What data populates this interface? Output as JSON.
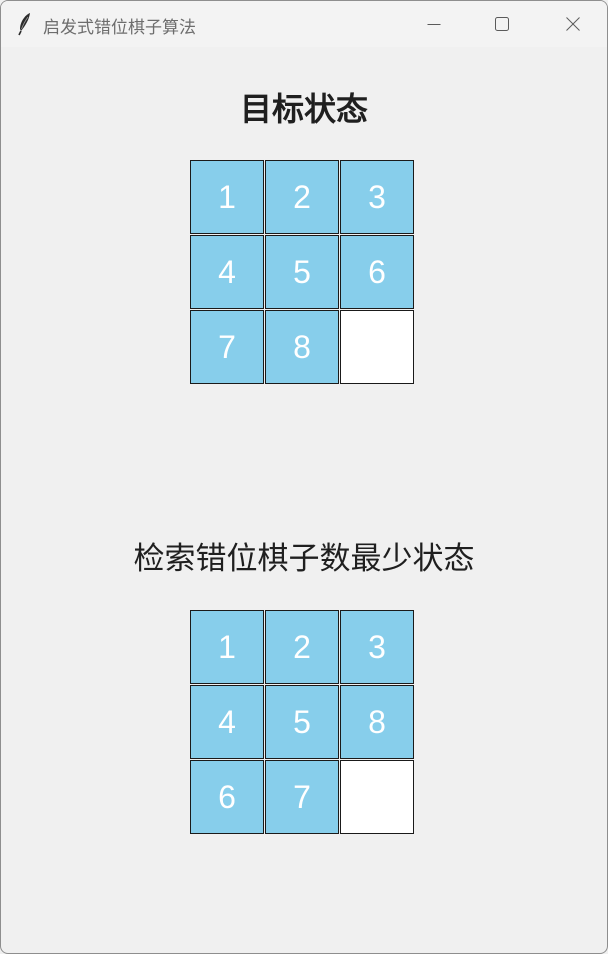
{
  "window": {
    "title": "启发式错位棋子算法",
    "icon": "feather-icon"
  },
  "controls": {
    "minimize_icon": "minimize-icon",
    "maximize_icon": "maximize-icon",
    "close_icon": "close-icon"
  },
  "goal": {
    "heading": "目标状态",
    "tiles": [
      "1",
      "2",
      "3",
      "4",
      "5",
      "6",
      "7",
      "8",
      ""
    ]
  },
  "result": {
    "heading": "检索错位棋子数最少状态",
    "tiles": [
      "1",
      "2",
      "3",
      "4",
      "5",
      "8",
      "6",
      "7",
      ""
    ]
  },
  "colors": {
    "tile_fill": "#87ceeb",
    "empty_fill": "#ffffff",
    "tile_text": "#ffffff",
    "background": "#f0f0f0"
  }
}
